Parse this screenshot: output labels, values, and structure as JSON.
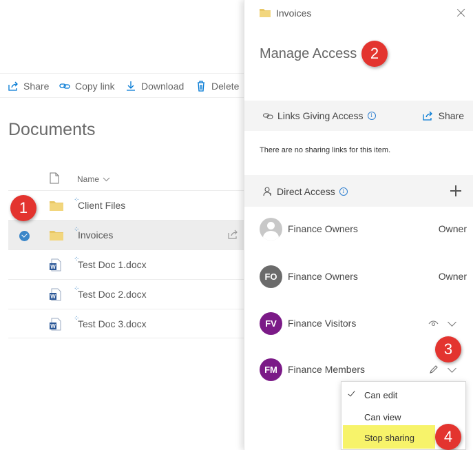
{
  "toolbar": {
    "share": "Share",
    "copy_link": "Copy link",
    "download": "Download",
    "delete": "Delete"
  },
  "library": {
    "title": "Documents",
    "name_header": "Name",
    "rows": [
      {
        "name": "Client Files",
        "type": "folder",
        "selected": false
      },
      {
        "name": "Invoices",
        "type": "folder",
        "selected": true
      },
      {
        "name": "Test Doc 1.docx",
        "type": "word"
      },
      {
        "name": "Test Doc 2.docx",
        "type": "word"
      },
      {
        "name": "Test Doc 3.docx",
        "type": "word"
      }
    ]
  },
  "panel": {
    "item_name": "Invoices",
    "title": "Manage Access",
    "links_section": {
      "title": "Links Giving Access",
      "share_label": "Share",
      "empty_text": "There are no sharing links for this item."
    },
    "direct_section": {
      "title": "Direct Access"
    },
    "members": [
      {
        "name": "Finance Owners",
        "initials": "",
        "role": "Owner",
        "color": "#c8c8c8"
      },
      {
        "name": "Finance Owners",
        "initials": "FO",
        "role": "Owner",
        "color": "#6b6b6b"
      },
      {
        "name": "Finance Visitors",
        "initials": "FV",
        "role": "",
        "color": "#7b1a87"
      },
      {
        "name": "Finance Members",
        "initials": "FM",
        "role": "",
        "color": "#7b1a87"
      }
    ]
  },
  "permission_menu": {
    "items": [
      "Can edit",
      "Can view",
      "Stop sharing"
    ],
    "checked": "Can edit",
    "highlighted": "Stop sharing",
    "highlight_color": "#f7f36a"
  },
  "callouts": [
    "1",
    "2",
    "3",
    "4"
  ],
  "colors": {
    "accent": "#0078d4",
    "callout": "#e3342f",
    "selection": "#ededed"
  }
}
